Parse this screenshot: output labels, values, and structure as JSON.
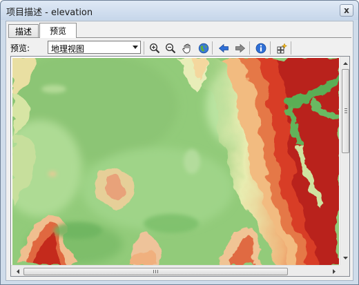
{
  "window": {
    "title": "项目描述 - elevation",
    "close_label": "x"
  },
  "tabs": [
    {
      "label": "描述",
      "active": false
    },
    {
      "label": "预览",
      "active": true
    }
  ],
  "toolbar": {
    "preview_label": "预览:",
    "preview_mode": {
      "selected": "地理视图"
    },
    "buttons": [
      {
        "name": "zoom-in-icon",
        "label": "zoom in"
      },
      {
        "name": "zoom-out-icon",
        "label": "zoom out"
      },
      {
        "name": "pan-hand-icon",
        "label": "pan"
      },
      {
        "name": "full-extent-globe-icon",
        "label": "full extent"
      },
      {
        "name": "back-arrow-icon",
        "label": "back"
      },
      {
        "name": "forward-arrow-icon",
        "label": "forward"
      },
      {
        "name": "identify-info-icon",
        "label": "identify"
      },
      {
        "name": "generate-thumbnail-icon",
        "label": "create thumbnail"
      }
    ]
  },
  "map": {
    "content": "elevation",
    "colors": {
      "low": "#8fc878",
      "mid": "#f2d9a0",
      "high": "#d9352a",
      "peak": "#b01d12",
      "valley": "#55a850"
    }
  },
  "colors": {
    "window_border": "#6d7f96",
    "titlebar": "#c6d6ea",
    "client_bg": "#f0f0f0",
    "accent_blue": "#2f6fd6"
  }
}
